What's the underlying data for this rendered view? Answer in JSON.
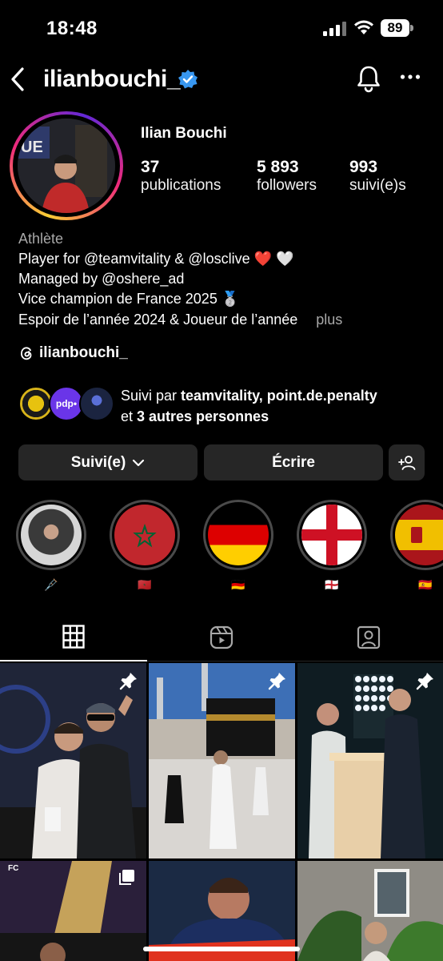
{
  "status_bar": {
    "time": "18:48",
    "battery": "89"
  },
  "header": {
    "username": "ilianbouchi_"
  },
  "profile": {
    "full_name": "Ilian Bouchi",
    "stats": [
      {
        "value": "37",
        "label": "publications"
      },
      {
        "value": "5 893",
        "label": "followers"
      },
      {
        "value": "993",
        "label": "suivi(e)s"
      }
    ],
    "category": "Athlète",
    "bio_lines": [
      "Player for @teamvitality & @losclive ❤️ 🤍",
      "Managed by @oshere_ad",
      "Vice champion de France 2025 🥈",
      "Espoir de l’année 2024 & Joueur de l’année"
    ],
    "more": "plus",
    "threads_handle": "ilianbouchi_"
  },
  "followed_by": {
    "prefix": "Suivi par ",
    "names": "teamvitality, point.de.penalty",
    "mid": "et ",
    "others": "3 autres personnes"
  },
  "buttons": {
    "following": "Suivi(e)",
    "message": "Écrire"
  },
  "highlights": [
    {
      "label": "🩼",
      "kind": "photo"
    },
    {
      "label": "🇲🇦",
      "kind": "morocco"
    },
    {
      "label": "🇩🇪",
      "kind": "germany"
    },
    {
      "label": "🏴󠁧󠁢󠁥󠁮󠁧󠁿",
      "kind": "england"
    },
    {
      "label": "🇪🇸",
      "kind": "spain"
    }
  ],
  "colors": {
    "verified": "#3897f0",
    "button_bg": "#262626",
    "muted": "#a8a8a8"
  }
}
